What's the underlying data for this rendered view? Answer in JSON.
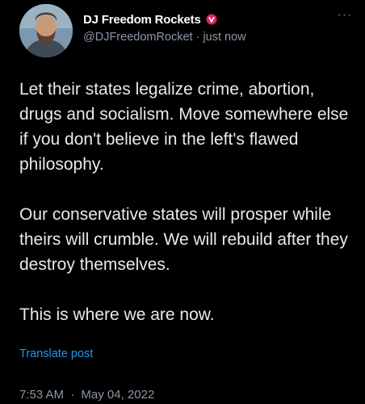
{
  "author": {
    "display_name": "DJ Freedom Rockets",
    "badge_icon": "parody-badge-icon",
    "badge_color": "#e0245e",
    "handle": "@DJFreedomRocket",
    "separator": "·",
    "time_relative": "just now"
  },
  "more_icon": "more-options-icon",
  "post": {
    "paragraphs": [
      "Let their states legalize crime, abortion, drugs and socialism. Move somewhere else if you don't believe in the left's flawed philosophy.",
      "Our conservative states will prosper while theirs will crumble. We will rebuild after they destroy themselves.",
      "This is where we are now."
    ],
    "translate_label": "Translate post",
    "time": "7:53 AM",
    "separator": "·",
    "date": "May 04, 2022"
  },
  "colors": {
    "background": "#000000",
    "text": "#e7e9ea",
    "secondary": "#8b98a5",
    "link": "#1d9bf0"
  }
}
